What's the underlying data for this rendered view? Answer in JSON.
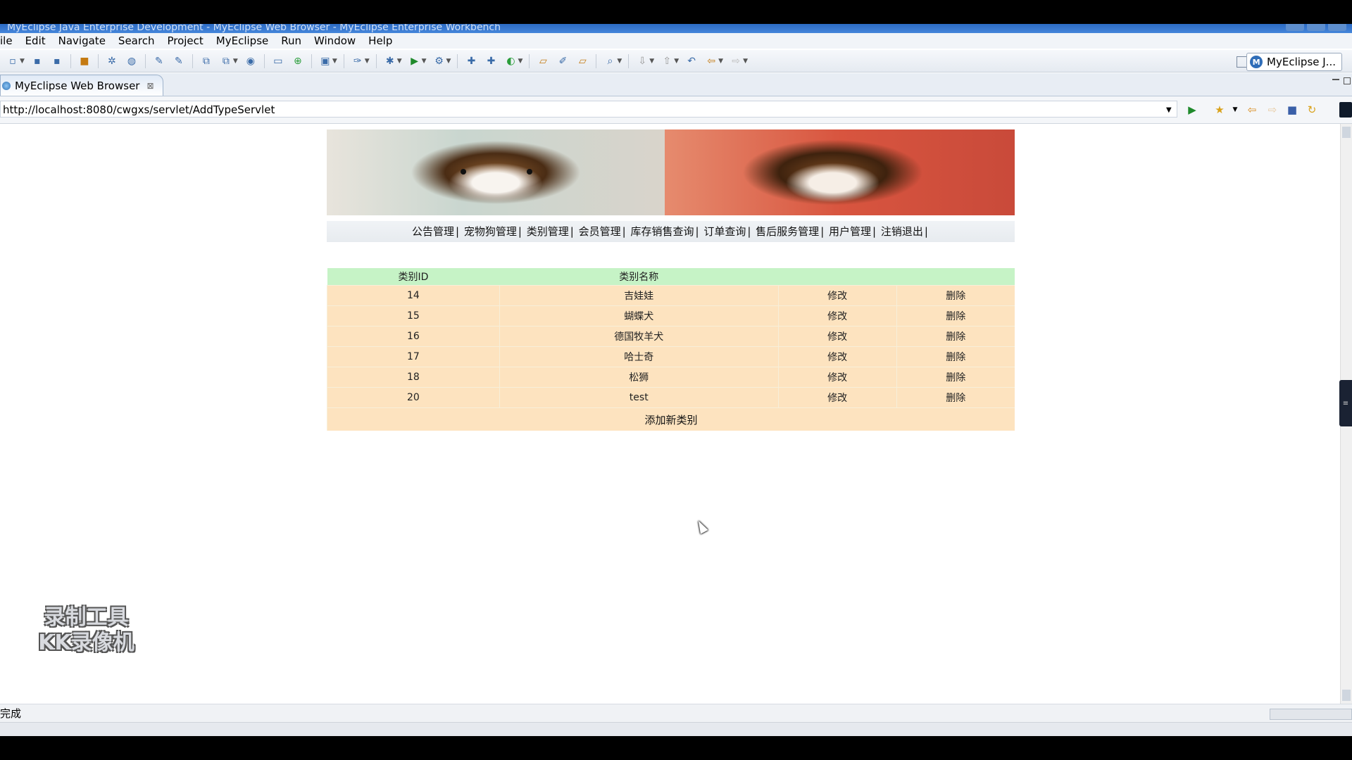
{
  "window": {
    "title": "MyEclipse Java Enterprise Development - MyEclipse Web Browser - MyEclipse Enterprise Workbench"
  },
  "menu": [
    "ile",
    "Edit",
    "Navigate",
    "Search",
    "Project",
    "MyEclipse",
    "Run",
    "Window",
    "Help"
  ],
  "toolbar": {
    "perspective_label": "MyEclipse J..."
  },
  "editor_tab": {
    "label": "MyEclipse Web Browser",
    "close": "⊠"
  },
  "browser": {
    "url": "http://localhost:8080/cwgxs/servlet/AddTypeServlet"
  },
  "page": {
    "nav": [
      "公告管理",
      "宠物狗管理",
      "类别管理",
      "会员管理",
      "库存销售查询",
      "订单查询",
      "售后服务管理",
      "用户管理",
      "注销退出"
    ],
    "nav_separator": "|",
    "table": {
      "headers": [
        "类别ID",
        "类别名称"
      ],
      "rows": [
        {
          "id": "14",
          "name": "吉娃娃",
          "edit": "修改",
          "delete": "删除"
        },
        {
          "id": "15",
          "name": "蝴蝶犬",
          "edit": "修改",
          "delete": "删除"
        },
        {
          "id": "16",
          "name": "德国牧羊犬",
          "edit": "修改",
          "delete": "删除"
        },
        {
          "id": "17",
          "name": "哈士奇",
          "edit": "修改",
          "delete": "删除"
        },
        {
          "id": "18",
          "name": "松狮",
          "edit": "修改",
          "delete": "删除"
        },
        {
          "id": "20",
          "name": "test",
          "edit": "修改",
          "delete": "删除"
        }
      ],
      "add_link": "添加新类别"
    }
  },
  "status": {
    "text": "完成"
  },
  "watermark": {
    "line1": "录制工具",
    "line2": "KK录像机"
  },
  "colors": {
    "header_green": "#c6f3c6",
    "row_peach": "#fde3bf",
    "title_blue": "#2c6bc3"
  }
}
